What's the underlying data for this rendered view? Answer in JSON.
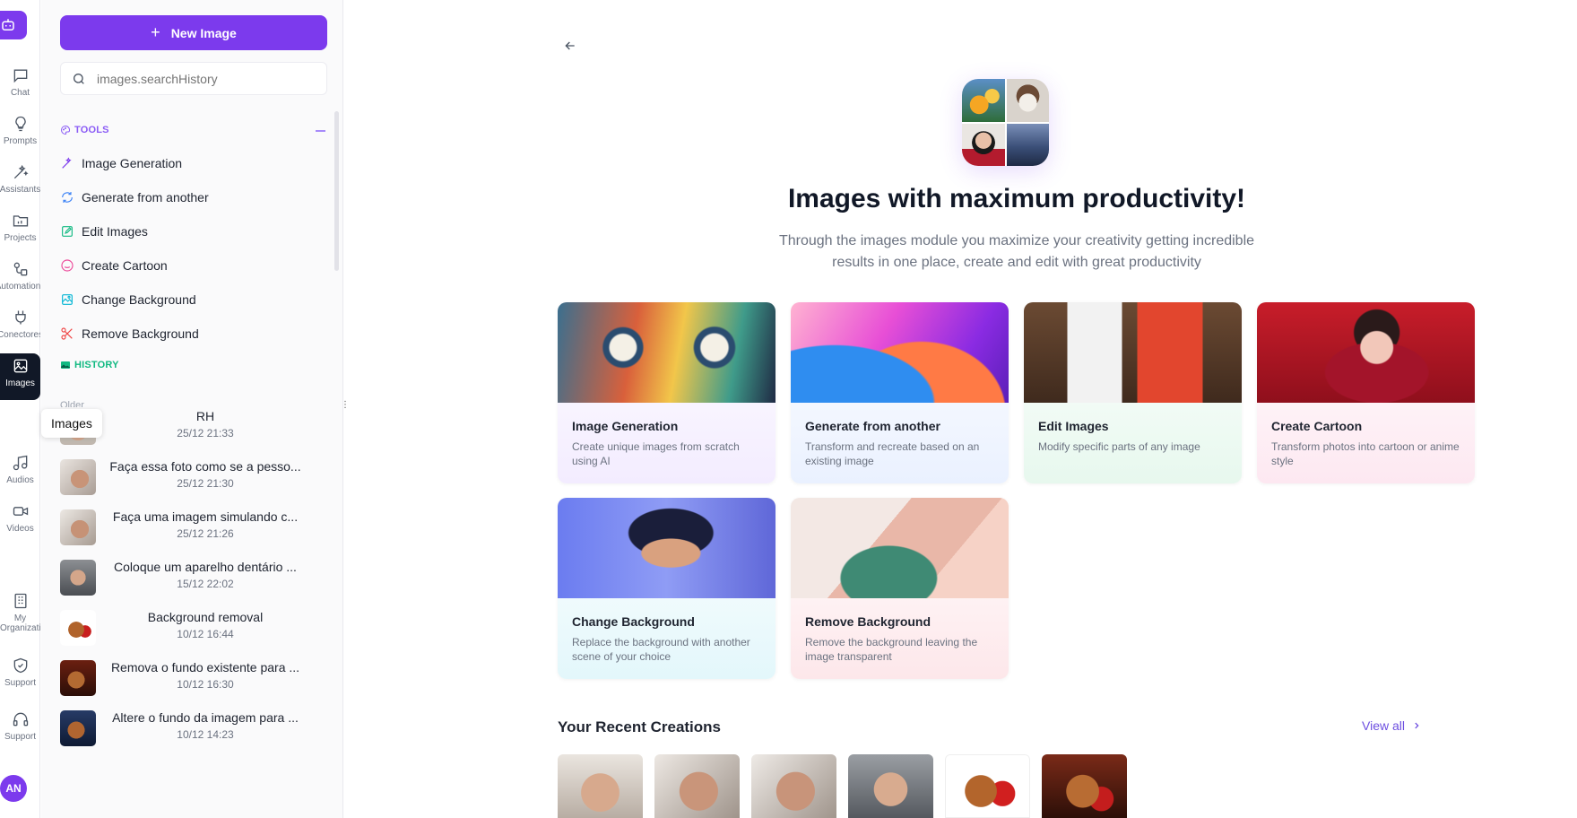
{
  "rail": {
    "items": [
      {
        "label": "Chat",
        "icon": "chat-icon"
      },
      {
        "label": "Prompts",
        "icon": "lightbulb-icon"
      },
      {
        "label": "Assistants",
        "icon": "magic-wand-icon"
      },
      {
        "label": "Projects",
        "icon": "folder-icon"
      },
      {
        "label": "Automations",
        "icon": "flow-icon"
      },
      {
        "label": "Conectores",
        "icon": "plug-icon"
      },
      {
        "label": "Images",
        "icon": "image-icon"
      },
      {
        "label": "Audios",
        "icon": "music-icon"
      },
      {
        "label": "Videos",
        "icon": "video-icon"
      },
      {
        "label": "My Organization",
        "icon": "building-icon"
      },
      {
        "label": "Support",
        "icon": "shield-icon"
      },
      {
        "label": "Support",
        "icon": "headphones-icon"
      }
    ],
    "tooltip": "Images",
    "avatar": "AN"
  },
  "sidebar": {
    "new_button": "New Image",
    "search_placeholder": "images.searchHistory",
    "tools_title": "TOOLS",
    "tools": [
      {
        "label": "Image Generation",
        "icon": "wand-icon",
        "color": "#7c3aed"
      },
      {
        "label": "Generate from another",
        "icon": "refresh-icon",
        "color": "#3b82f6"
      },
      {
        "label": "Edit Images",
        "icon": "edit-icon",
        "color": "#10b981"
      },
      {
        "label": "Create Cartoon",
        "icon": "smile-icon",
        "color": "#ec4899"
      },
      {
        "label": "Change Background",
        "icon": "image-edit-icon",
        "color": "#06b6d4"
      },
      {
        "label": "Remove Background",
        "icon": "scissors-icon",
        "color": "#ef4444"
      }
    ],
    "history_title": "HISTORY",
    "history_group": "Older",
    "history": [
      {
        "title": "RH",
        "date": "25/12 21:33"
      },
      {
        "title": "Faça essa foto como se a pesso...",
        "date": "25/12 21:30"
      },
      {
        "title": "Faça uma imagem simulando c...",
        "date": "25/12 21:26"
      },
      {
        "title": "Coloque um aparelho dentário ...",
        "date": "15/12 22:02"
      },
      {
        "title": "Background removal",
        "date": "10/12 16:44"
      },
      {
        "title": "Remova o fundo existente para ...",
        "date": "10/12 16:30"
      },
      {
        "title": "Altere o fundo da imagem para ...",
        "date": "10/12 14:23"
      }
    ]
  },
  "main": {
    "title": "Images with maximum productivity!",
    "subtitle": "Through the images module you maximize your creativity getting incredible results in one place, create and edit with great productivity",
    "cards": [
      {
        "title": "Image Generation",
        "desc": "Create unique images from scratch using AI"
      },
      {
        "title": "Generate from another",
        "desc": "Transform and recreate based on an existing image"
      },
      {
        "title": "Edit Images",
        "desc": "Modify specific parts of any image"
      },
      {
        "title": "Create Cartoon",
        "desc": "Transform photos into cartoon or anime style"
      },
      {
        "title": "Change Background",
        "desc": "Replace the background with another scene of your choice"
      },
      {
        "title": "Remove Background",
        "desc": "Remove the background leaving the image transparent"
      }
    ],
    "recent_title": "Your Recent Creations",
    "view_all": "View all"
  },
  "colors": {
    "accent": "#7c3aed",
    "link": "#6d4fe0",
    "history_green": "#10b981"
  }
}
